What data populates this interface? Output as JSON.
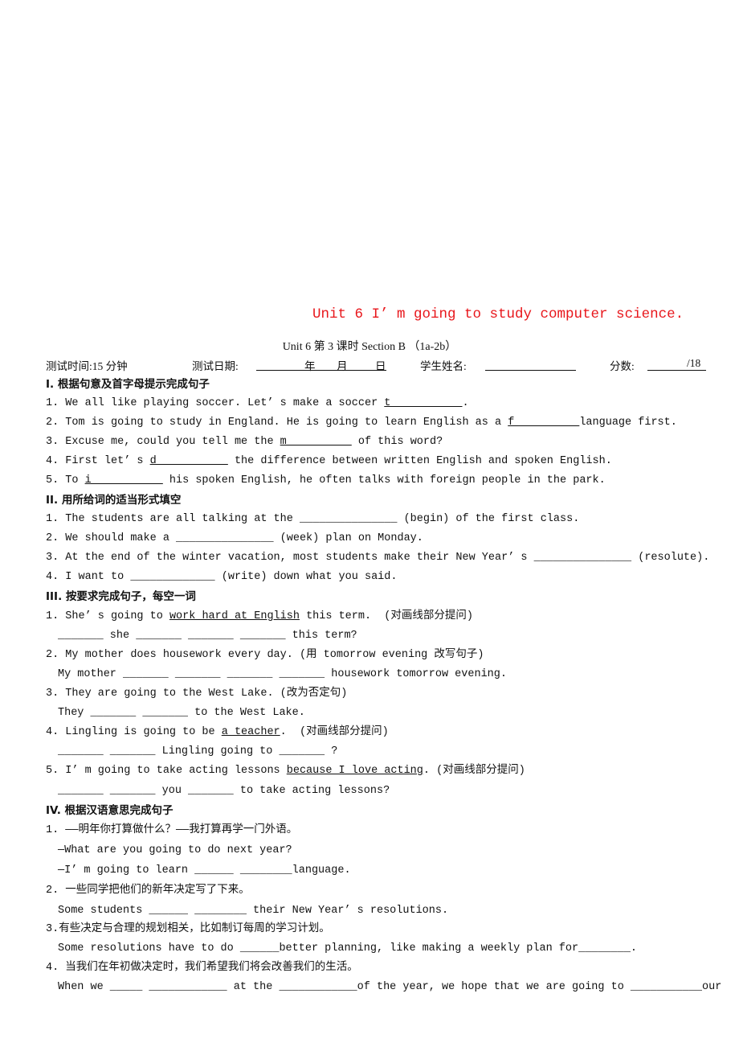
{
  "title": "Unit 6 I’ m going to study computer science.",
  "subtitle": "Unit 6 第 3 课时 Section B （1a-2b）",
  "info": {
    "time": "测试时间:15 分钟",
    "date_label": "测试日期:",
    "year": "年",
    "month": "月",
    "day": "日",
    "name_label": "学生姓名:",
    "score_label": "分数:",
    "score_total": "/18"
  },
  "lines": [
    {
      "indent": 0,
      "head": true,
      "segs": [
        {
          "t": "I. 根据句意及首字母提示完成句子"
        }
      ]
    },
    {
      "indent": 0,
      "segs": [
        {
          "t": "1. We all like playing soccer. Let’ s make a soccer "
        },
        {
          "u": "t           "
        },
        {
          "t": "."
        }
      ]
    },
    {
      "indent": 0,
      "segs": [
        {
          "t": "2. Tom is going to study in England. He is going to learn English as a "
        },
        {
          "u": "f          "
        },
        {
          "t": "language first."
        }
      ]
    },
    {
      "indent": 0,
      "segs": [
        {
          "t": "3. Excuse me, could you tell me the "
        },
        {
          "u": "m          "
        },
        {
          "t": " of this word?"
        }
      ]
    },
    {
      "indent": 0,
      "segs": [
        {
          "t": "4. First let’ s "
        },
        {
          "u": "d           "
        },
        {
          "t": " the difference between written English and spoken English."
        }
      ]
    },
    {
      "indent": 0,
      "segs": [
        {
          "t": "5. To "
        },
        {
          "u": "i           "
        },
        {
          "t": " his spoken English, he often talks with foreign people in the park."
        }
      ]
    },
    {
      "indent": 0,
      "head": true,
      "segs": [
        {
          "t": "II. 用所给词的适当形式填空"
        }
      ]
    },
    {
      "indent": 0,
      "segs": [
        {
          "t": "1. The students are all talking at the _______________ (begin) of the first class."
        }
      ]
    },
    {
      "indent": 0,
      "segs": [
        {
          "t": "2. We should make a _______________ (week) plan on Monday."
        }
      ]
    },
    {
      "indent": 0,
      "segs": [
        {
          "t": "3. At the end of the winter vacation, most students make their New Year’ s _______________ (resolute)."
        }
      ]
    },
    {
      "indent": 0,
      "segs": [
        {
          "t": "4. I want to _____________ (write) down what you said."
        }
      ]
    },
    {
      "indent": 0,
      "head": true,
      "segs": [
        {
          "t": "III. 按要求完成句子，每空一词"
        }
      ]
    },
    {
      "indent": 0,
      "segs": [
        {
          "t": "1. She’ s going to "
        },
        {
          "u": "work hard at English"
        },
        {
          "t": " this term.  (对画线部分提问)"
        }
      ]
    },
    {
      "indent": 2,
      "segs": [
        {
          "t": "_______ she _______ _______ _______ this term?"
        }
      ]
    },
    {
      "indent": 0,
      "segs": [
        {
          "t": "2. My mother does housework every day. (用 tomorrow evening 改写句子)"
        }
      ]
    },
    {
      "indent": 1,
      "segs": [
        {
          "t": "My mother _______ _______ _______ _______ housework tomorrow evening."
        }
      ]
    },
    {
      "indent": 0,
      "segs": [
        {
          "t": "3. They are going to the West Lake. (改为否定句)"
        }
      ]
    },
    {
      "indent": 1,
      "segs": [
        {
          "t": "They _______ _______ to the West Lake."
        }
      ]
    },
    {
      "indent": 0,
      "segs": [
        {
          "t": "4. Lingling is going to be "
        },
        {
          "u": "a teacher"
        },
        {
          "t": ".  (对画线部分提问)"
        }
      ]
    },
    {
      "indent": 1,
      "segs": [
        {
          "t": "_______ _______ Lingling going to _______ ?"
        }
      ]
    },
    {
      "indent": 0,
      "segs": [
        {
          "t": "5. I’ m going to take acting lessons "
        },
        {
          "u": "because I love acting"
        },
        {
          "t": ". (对画线部分提问)"
        }
      ]
    },
    {
      "indent": 1,
      "segs": [
        {
          "t": "_______ _______ you _______ to take acting lessons?"
        }
      ]
    },
    {
      "indent": 0,
      "head": true,
      "segs": [
        {
          "t": "IV. 根据汉语意思完成句子"
        }
      ]
    },
    {
      "indent": 0,
      "segs": [
        {
          "t": "1. ——明年你打算做什么？——我打算再学一门外语。"
        }
      ]
    },
    {
      "indent": 1,
      "segs": [
        {
          "t": "—What are you going to do next year?"
        }
      ]
    },
    {
      "indent": 1,
      "segs": [
        {
          "t": "—I’ m going to learn ______ ________language."
        }
      ]
    },
    {
      "indent": 0,
      "segs": [
        {
          "t": "2. 一些同学把他们的新年决定写了下来。"
        }
      ]
    },
    {
      "indent": 1,
      "segs": [
        {
          "t": "Some students ______ ________ their New Year’ s resolutions."
        }
      ]
    },
    {
      "indent": 0,
      "segs": [
        {
          "t": "3.有些决定与合理的规划相关，比如制订每周的学习计划。"
        }
      ]
    },
    {
      "indent": 1,
      "segs": [
        {
          "t": "Some resolutions have to do ______better planning, like making a weekly plan for________."
        }
      ]
    },
    {
      "indent": 0,
      "segs": [
        {
          "t": "4. 当我们在年初做决定时，我们希望我们将会改善我们的生活。"
        }
      ]
    },
    {
      "indent": 1,
      "segs": [
        {
          "t": "When we _____ ____________ at the ____________of the year, we hope that we are going to ___________our"
        }
      ]
    }
  ]
}
